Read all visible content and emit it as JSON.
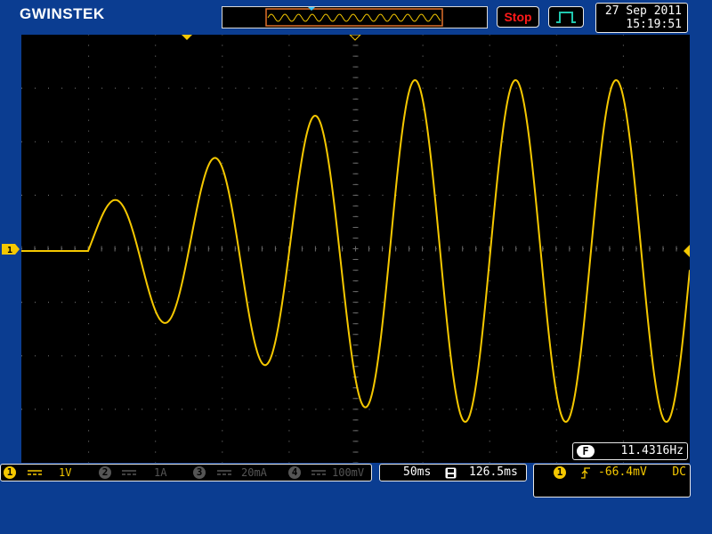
{
  "brand": "GWINSTEK",
  "status": {
    "run_state": "Stop"
  },
  "datetime": {
    "date": "27 Sep 2011",
    "time": "15:19:51"
  },
  "channels": [
    {
      "number": "1",
      "coupling_icon": "dc-coupling-icon",
      "scale": "1V",
      "active": true
    },
    {
      "number": "2",
      "coupling_icon": "dc-coupling-icon",
      "scale": "1A",
      "active": false
    },
    {
      "number": "3",
      "coupling_icon": "dc-coupling-icon",
      "scale": "20mA",
      "active": false
    },
    {
      "number": "4",
      "coupling_icon": "dc-coupling-icon",
      "scale": "100mV",
      "active": false
    }
  ],
  "timebase": {
    "time_div": "50ms",
    "position": "126.5ms",
    "position_icon": "position-icon"
  },
  "trigger": {
    "source": "1",
    "slope_icon": "rising-edge-icon",
    "level": "-66.4mV",
    "coupling": "DC"
  },
  "measurement": {
    "badge": "F",
    "frequency": "11.4316Hz"
  },
  "colors": {
    "background": "#0b3d91",
    "trace": "#f5c800",
    "grid": "#6a6a6a",
    "stop": "#ff1a1a",
    "overview_frame": "#e0702a",
    "trigger_mode": "#20c8b0",
    "inactive_channel": "#555555"
  }
}
